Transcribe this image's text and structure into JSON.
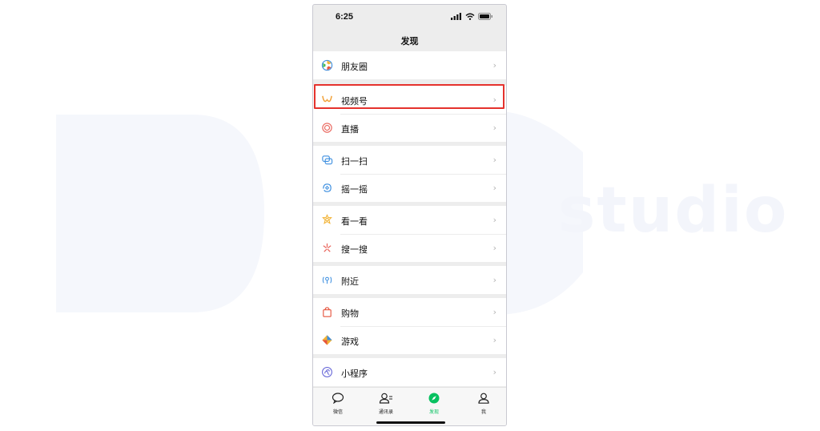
{
  "watermark": {
    "text": "studio"
  },
  "status_bar": {
    "time": "6:25"
  },
  "nav": {
    "title": "发现"
  },
  "groups": [
    {
      "items": [
        {
          "label": "朋友圈",
          "icon": "moments-icon"
        }
      ]
    },
    {
      "items": [
        {
          "label": "视频号",
          "icon": "channels-icon"
        },
        {
          "label": "直播",
          "icon": "live-icon"
        }
      ]
    },
    {
      "items": [
        {
          "label": "扫一扫",
          "icon": "scan-icon"
        },
        {
          "label": "摇一摇",
          "icon": "shake-icon"
        }
      ]
    },
    {
      "items": [
        {
          "label": "看一看",
          "icon": "top-stories-icon"
        },
        {
          "label": "搜一搜",
          "icon": "search-icon"
        }
      ]
    },
    {
      "items": [
        {
          "label": "附近",
          "icon": "nearby-icon"
        }
      ]
    },
    {
      "items": [
        {
          "label": "购物",
          "icon": "shopping-bag-icon"
        },
        {
          "label": "游戏",
          "icon": "games-icon"
        }
      ]
    },
    {
      "items": [
        {
          "label": "小程序",
          "icon": "mini-programs-icon"
        }
      ]
    }
  ],
  "chevron": "›",
  "tabbar": {
    "tabs": [
      {
        "label": "微信",
        "icon": "chat-bubble-icon",
        "active": false
      },
      {
        "label": "通讯录",
        "icon": "contacts-icon",
        "active": false
      },
      {
        "label": "发现",
        "icon": "discover-compass-icon",
        "active": true
      },
      {
        "label": "我",
        "icon": "me-icon",
        "active": false
      }
    ]
  },
  "colors": {
    "accent": "#07c160",
    "highlight_border": "#e5322d",
    "background": "#ededed"
  }
}
